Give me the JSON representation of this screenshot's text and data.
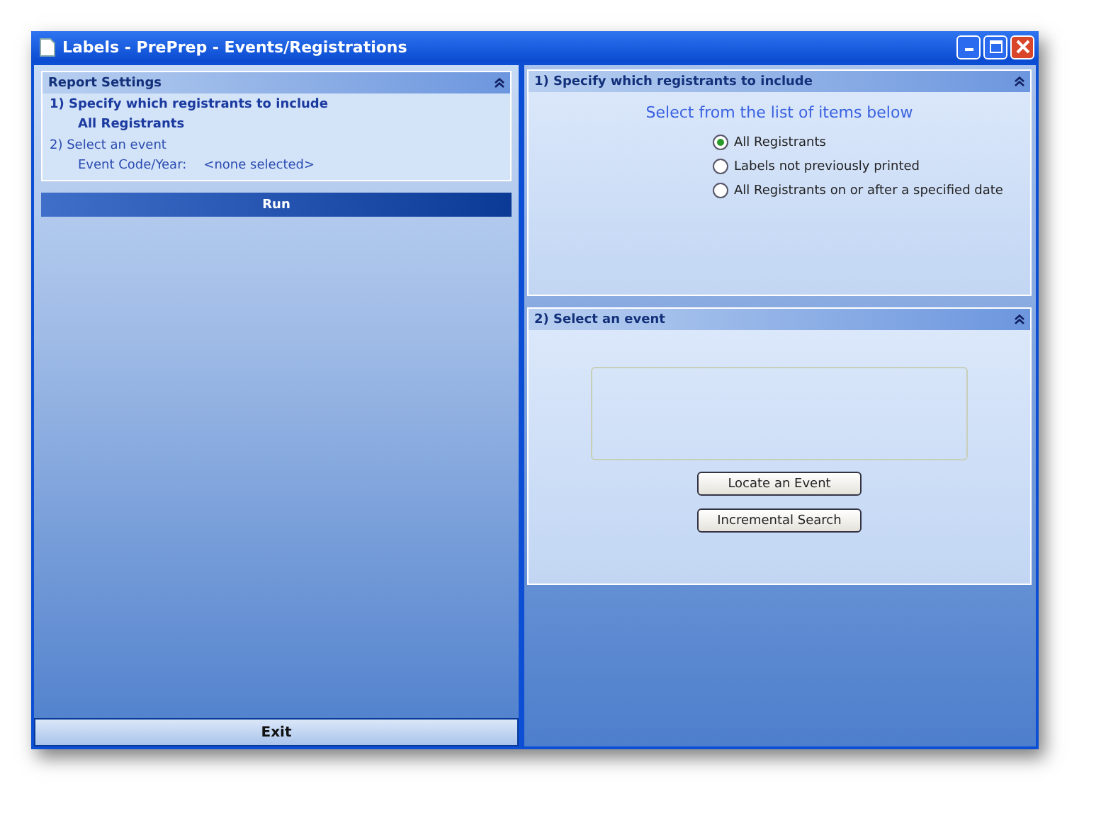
{
  "window": {
    "title": "Labels - PrePrep - Events/Registrations"
  },
  "report_settings": {
    "title": "Report Settings",
    "steps": [
      {
        "label": "1)  Specify which registrants to include",
        "value": "All Registrants",
        "done": true
      },
      {
        "label": "2)  Select an event",
        "field_label": "Event Code/Year:",
        "value": "<none selected>",
        "done": false
      }
    ]
  },
  "run_button": "Run",
  "exit_button": "Exit",
  "include_panel": {
    "title": "1)  Specify which registrants to include",
    "prompt": "Select from the list of items below",
    "options": [
      {
        "label": "All Registrants",
        "selected": true
      },
      {
        "label": "Labels not previously printed",
        "selected": false
      },
      {
        "label": "All Registrants on or after a specified date",
        "selected": false
      }
    ]
  },
  "event_panel": {
    "title": "2)  Select an event",
    "buttons": [
      "Locate an Event",
      "Incremental Search"
    ]
  }
}
